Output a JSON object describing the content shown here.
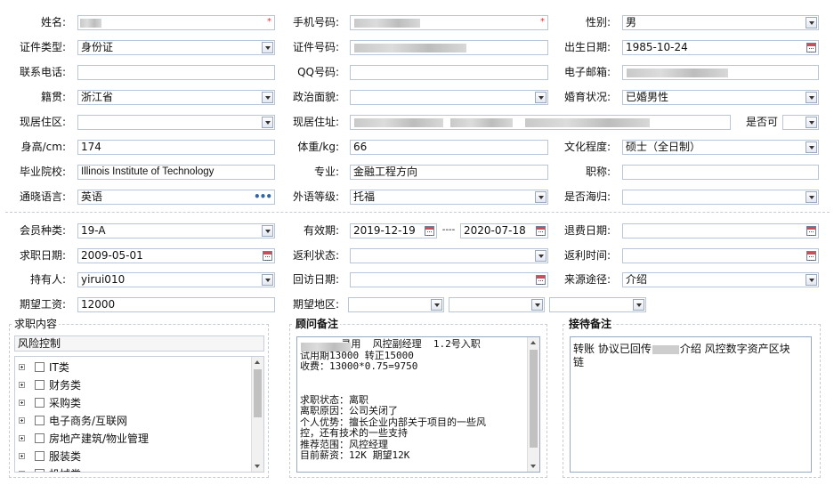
{
  "form": {
    "name": {
      "label": "姓名:"
    },
    "mobile": {
      "label": "手机号码:"
    },
    "gender": {
      "label": "性别:",
      "value": "男"
    },
    "id_type": {
      "label": "证件类型:",
      "value": "身份证"
    },
    "id_number": {
      "label": "证件号码:"
    },
    "birth_date": {
      "label": "出生日期:",
      "value": "1985-10-24"
    },
    "phone": {
      "label": "联系电话:"
    },
    "qq": {
      "label": "QQ号码:"
    },
    "email": {
      "label": "电子邮箱:"
    },
    "native_place": {
      "label": "籍贯:",
      "value": "浙江省"
    },
    "political": {
      "label": "政治面貌:"
    },
    "marital": {
      "label": "婚育状况:",
      "value": "已婚男性"
    },
    "residence_area": {
      "label": "现居住区:"
    },
    "residence_addr": {
      "label": "现居住址:"
    },
    "is_ok": {
      "label": "是否可"
    },
    "height": {
      "label": "身高/cm:",
      "value": "174"
    },
    "weight": {
      "label": "体重/kg:",
      "value": "66"
    },
    "education": {
      "label": "文化程度:",
      "value": "硕士（全日制）"
    },
    "school": {
      "label": "毕业院校:",
      "value": "Illinois Institute of Technology"
    },
    "major": {
      "label": "专业:",
      "value": "金融工程方向"
    },
    "title": {
      "label": "职称:"
    },
    "language": {
      "label": "通晓语言:",
      "value": "英语"
    },
    "lang_level": {
      "label": "外语等级:",
      "value": "托福"
    },
    "overseas": {
      "label": "是否海归:"
    }
  },
  "member": {
    "type": {
      "label": "会员种类:",
      "value": "19-A"
    },
    "valid": {
      "label": "有效期:",
      "from": "2019-12-19",
      "sep": "----",
      "to": "2020-07-18"
    },
    "refund_date": {
      "label": "退费日期:"
    },
    "job_date": {
      "label": "求职日期:",
      "value": "2009-05-01"
    },
    "rebate_status": {
      "label": "返利状态:"
    },
    "rebate_time": {
      "label": "返利时间:"
    },
    "holder": {
      "label": "持有人:",
      "value": "yirui010"
    },
    "visit_date": {
      "label": "回访日期:"
    },
    "source": {
      "label": "来源途径:",
      "value": "介绍"
    },
    "salary": {
      "label": "期望工资:",
      "value": "12000"
    },
    "region": {
      "label": "期望地区:"
    }
  },
  "job_content": {
    "title": "求职内容",
    "search_value": "风险控制",
    "tree": [
      "IT类",
      "财务类",
      "采购类",
      "电子商务/互联网",
      "房地产建筑/物业管理",
      "服装类",
      "机械类"
    ]
  },
  "advisor_note": {
    "title": "顾问备注",
    "lines": [
      "       录用  风控副经理  1.2号入职",
      "试用期13000 转正15000",
      "收费：13000*0.75=9750",
      "",
      "",
      "求职状态：离职",
      "离职原因：公司关闭了",
      "个人优势：擅长企业内部关于项目的一些风",
      "控，还有技术的一些支持",
      "推荐范围：风控经理",
      "目前薪资：12K 期望12K"
    ]
  },
  "reception_note": {
    "title": "接待备注",
    "line1_a": "转账 协议已回传",
    "line1_b": "介绍 风控数字资产区块",
    "line2": "链"
  },
  "colors": {
    "border": "#9aa9bf",
    "required": "#ee3333",
    "accent": "#3465a4"
  }
}
